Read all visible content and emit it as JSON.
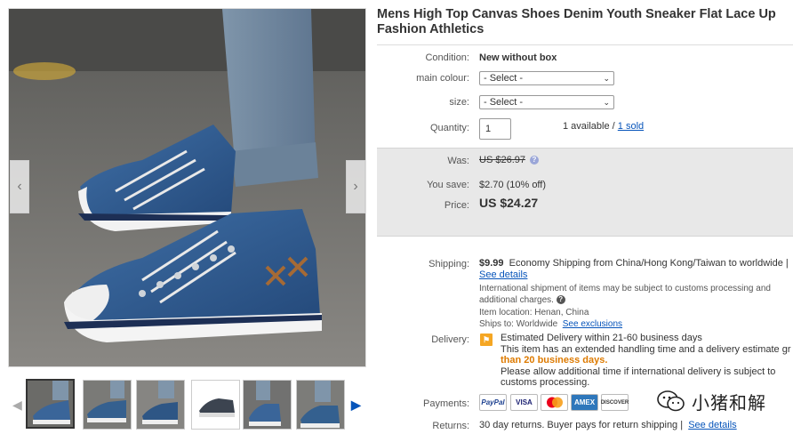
{
  "listing": {
    "title": "Mens High Top Canvas Shoes Denim Youth Sneaker Flat Lace Up Fashion Athletics"
  },
  "details": {
    "condition_label": "Condition:",
    "condition_value": "New without box",
    "colour_label": "main colour:",
    "colour_select": "- Select -",
    "size_label": "size:",
    "size_select": "- Select -",
    "quantity_label": "Quantity:",
    "quantity_value": "1",
    "available_text": "1 available /",
    "sold_link": "1 sold"
  },
  "pricing": {
    "was_label": "Was:",
    "was_value": "US $26.97",
    "save_label": "You save:",
    "save_value": "$2.70 (10% off)",
    "price_label": "Price:",
    "price_value": "US $24.27"
  },
  "shipping": {
    "label": "Shipping:",
    "cost": "$9.99",
    "method": "Economy Shipping from China/Hong Kong/Taiwan to worldwide |",
    "details_link": "See details",
    "customs_note": "International shipment of items may be subject to customs processing and additional charges.",
    "item_location": "Item location:  Henan, China",
    "ships_to": "Ships to:  Worldwide",
    "exclusions_link": "See exclusions"
  },
  "delivery": {
    "label": "Delivery:",
    "estimate": "Estimated Delivery within 21-60 business days",
    "handling_a": "This item has an extended handling time and a delivery estimate gr",
    "handling_b": "than 20 business days.",
    "allow": "Please allow additional time if international delivery is subject to customs processing."
  },
  "payments": {
    "label": "Payments:",
    "methods": [
      "PayPal",
      "VISA",
      "MasterCard",
      "AMEX",
      "DISCOVER"
    ]
  },
  "returns": {
    "label": "Returns:",
    "text": "30 day returns. Buyer pays for return shipping |",
    "details_link": "See details"
  },
  "watermark": {
    "text": "小猪和解"
  },
  "icons": {
    "gallery_prev": "chevron-left-icon",
    "gallery_next": "chevron-right-icon",
    "info": "info-icon",
    "help": "question-icon",
    "delivery": "flag-icon",
    "wechat": "wechat-icon"
  },
  "colors": {
    "link": "#0654ba",
    "price_box": "#e8e8e8",
    "accent_orange": "#dd7a00",
    "delivery_icon": "#f5a623"
  }
}
